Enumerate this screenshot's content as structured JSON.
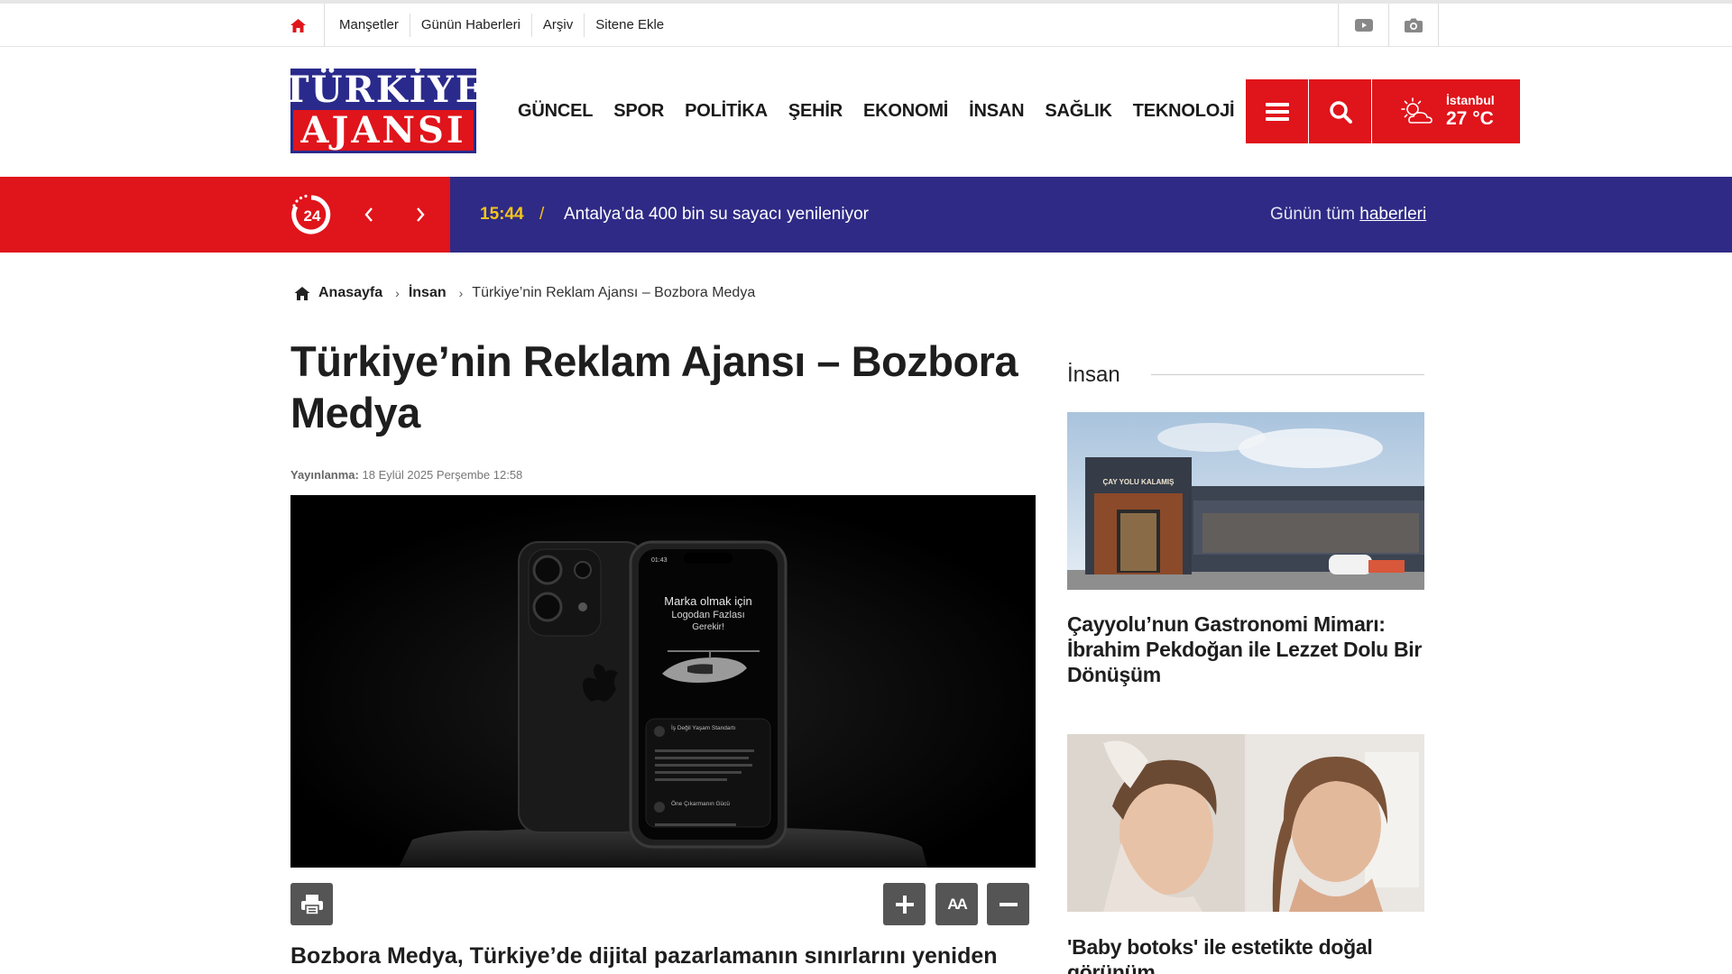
{
  "topbar": {
    "links": [
      "Manşetler",
      "Günün Haberleri",
      "Arşiv",
      "Sitene Ekle"
    ],
    "icons": [
      "home-icon",
      "youtube-icon",
      "camera-icon"
    ]
  },
  "logo": {
    "line1": "TÜRKİYE",
    "line2": "AJANSI"
  },
  "nav": [
    "GÜNCEL",
    "SPOR",
    "POLİTİKA",
    "ŞEHİR",
    "EKONOMİ",
    "İNSAN",
    "SAĞLIK",
    "TEKNOLOJİ"
  ],
  "weather": {
    "city": "İstanbul",
    "temp": "27 °C"
  },
  "ticker": {
    "badge": "24",
    "time": "15:44",
    "separator": "/",
    "headline": "Antalya’da 400 bin su sayacı yenileniyor",
    "all_prefix": "Günün tüm",
    "all_link": "haberleri"
  },
  "breadcrumb": {
    "home": "Anasayfa",
    "category": "İnsan",
    "current": "Türkiye’nin Reklam Ajansı – Bozbora Medya"
  },
  "article": {
    "title": "Türkiye’nin Reklam Ajansı – Bozbora Medya",
    "published_label": "Yayınlanma:",
    "published_date": "18 Eylül 2025 Perşembe 12:58",
    "lead": "Bozbora Medya, Türkiye’de dijital pazarlamanın sınırlarını yeniden",
    "hero_screen": {
      "time": "01:43",
      "headline_1": "Marka olmak için",
      "headline_2": "Logodan Fazlası",
      "headline_3": "Gerekir!",
      "item1_title": "İş Değil Yaşam Standartı",
      "item2_title": "Öne Çıkarmanın Gücü"
    },
    "font_sizer_label": "AA"
  },
  "sidebar": {
    "heading": "İnsan",
    "cards": [
      {
        "title": "Çayyolu’nun Gastronomi Mimarı: İbrahim Pekdoğan ile Lezzet Dolu Bir Dönüşüm",
        "sign": "ÇAY YOLU KALAMIŞ"
      },
      {
        "title": "'Baby botoks' ile estetikte doğal görünüm"
      }
    ]
  },
  "colors": {
    "brand_red": "#e0141b",
    "brand_navy": "#2f2a86",
    "accent_yellow": "#f5c518"
  }
}
